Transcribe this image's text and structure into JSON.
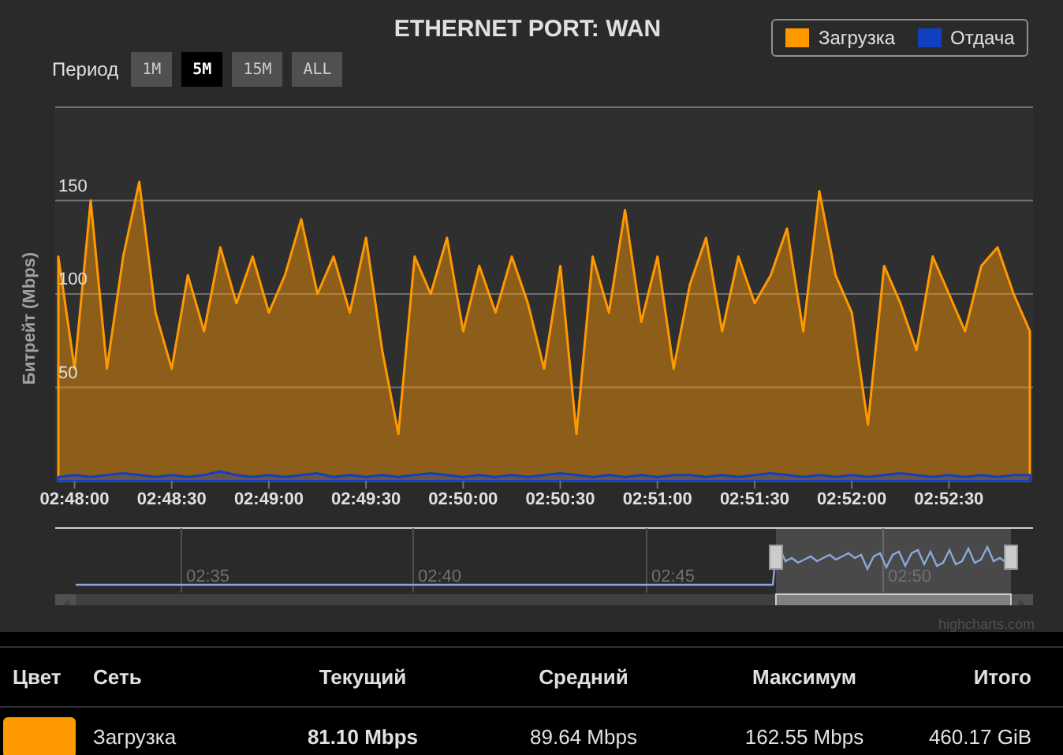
{
  "chart": {
    "title": "ETHERNET PORT: WAN",
    "period": {
      "label": "Период",
      "buttons": [
        {
          "label": "1M",
          "selected": false
        },
        {
          "label": "5M",
          "selected": true
        },
        {
          "label": "15M",
          "selected": false
        },
        {
          "label": "ALL",
          "selected": false
        }
      ]
    },
    "chart_data": {
      "type": "area",
      "ylabel": "Битрейт (Mbps)",
      "categories": [
        null,
        "02:48:00",
        null,
        null,
        null,
        null,
        null,
        "02:48:30",
        null,
        null,
        null,
        null,
        null,
        "02:49:00",
        null,
        null,
        null,
        null,
        null,
        "02:49:30",
        null,
        null,
        null,
        null,
        null,
        "02:50:00",
        null,
        null,
        null,
        null,
        null,
        "02:50:30",
        null,
        null,
        null,
        null,
        null,
        "02:51:00",
        null,
        null,
        null,
        null,
        null,
        "02:51:30",
        null,
        null,
        null,
        null,
        null,
        "02:52:00",
        null,
        null,
        null,
        null,
        null,
        "02:52:30",
        null,
        null,
        null,
        null,
        null
      ],
      "series": [
        {
          "name": "Загрузка",
          "color": "#ff9900",
          "values": [
            120,
            60,
            150,
            60,
            120,
            160,
            90,
            60,
            110,
            80,
            125,
            95,
            120,
            90,
            110,
            140,
            100,
            120,
            90,
            130,
            70,
            25,
            120,
            100,
            130,
            80,
            115,
            90,
            120,
            95,
            60,
            115,
            25,
            120,
            90,
            145,
            85,
            120,
            60,
            105,
            130,
            80,
            120,
            95,
            110,
            135,
            80,
            155,
            110,
            90,
            30,
            115,
            95,
            70,
            120,
            100,
            80,
            115,
            125,
            100,
            80
          ]
        },
        {
          "name": "Отдача",
          "color": "#1040c0",
          "values": [
            2,
            3,
            2,
            3,
            4,
            3,
            2,
            3,
            2,
            3,
            5,
            3,
            2,
            3,
            2,
            3,
            4,
            2,
            3,
            2,
            3,
            2,
            3,
            4,
            3,
            2,
            3,
            2,
            3,
            2,
            3,
            4,
            3,
            2,
            3,
            2,
            3,
            2,
            3,
            3,
            2,
            3,
            2,
            3,
            4,
            3,
            2,
            3,
            2,
            3,
            2,
            3,
            4,
            3,
            2,
            3,
            2,
            3,
            2,
            3,
            3
          ]
        }
      ],
      "ylim": [
        0,
        200
      ],
      "grid": true,
      "yticks": [
        50,
        100,
        150
      ]
    },
    "navigator": {
      "labels": [
        "02:35",
        "02:40",
        "02:45",
        "02:50"
      ]
    },
    "credits": "highcharts.com"
  },
  "table": {
    "columns": [
      "Цвет",
      "Сеть",
      "Текущий",
      "Средний",
      "Максимум",
      "Итого"
    ],
    "rows": [
      {
        "color": "#ff9900",
        "cells": [
          "",
          "Загрузка",
          "81.10 Mbps",
          "89.64 Mbps",
          "162.55 Mbps",
          "460.17 GiB"
        ]
      }
    ]
  }
}
